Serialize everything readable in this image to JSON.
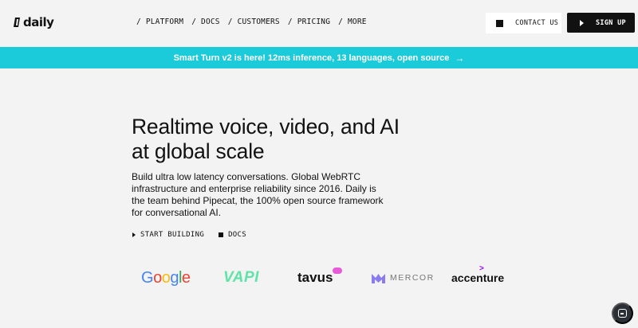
{
  "header": {
    "logo_text": "daily",
    "nav": [
      {
        "label": "/ PLATFORM"
      },
      {
        "label": "/ DOCS"
      },
      {
        "label": "/ CUSTOMERS"
      },
      {
        "label": "/ PRICING"
      },
      {
        "label": "/ MORE"
      }
    ],
    "contact_label": "CONTACT US",
    "signup_label": "SIGN UP"
  },
  "announcement": {
    "text": "Smart Turn v2 is here! 12ms inference, 13 languages, open source",
    "arrow_icon": "arrow-right-icon"
  },
  "hero": {
    "headline": "Realtime voice, video, and AI at global scale",
    "subtext": "Build ultra low latency conversations. Global WebRTC infrastructure and enterprise reliability since 2016. Daily is the team behind Pipecat, the 100% open source framework for conversational AI.",
    "cta_primary": "START BUILDING",
    "cta_secondary": "DOCS"
  },
  "customers": {
    "google": "Google",
    "vapi": "VAPI",
    "tavus": "tavus",
    "mercor": "MERCOR",
    "accenture": "accenture"
  },
  "colors": {
    "announcement_bg": "#1ccbd9",
    "signup_bg": "#111111",
    "page_bg": "#f3f3f3"
  }
}
